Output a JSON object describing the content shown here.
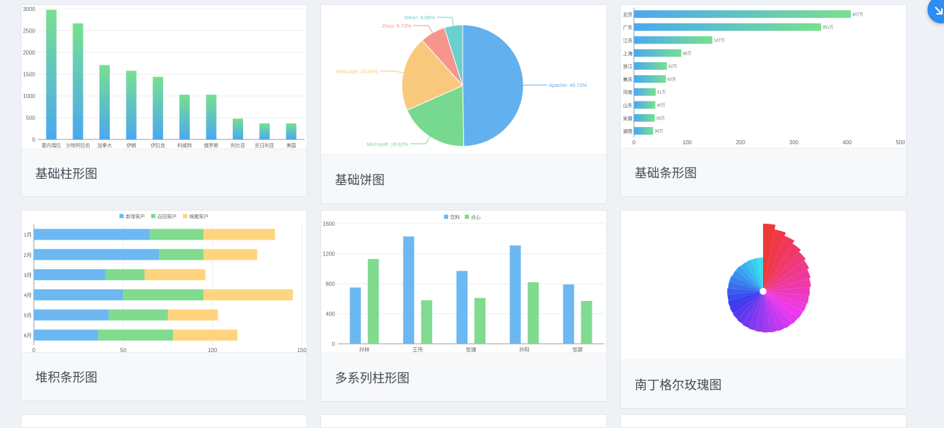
{
  "cards": [
    {
      "id": "basic-bar",
      "caption": "基础柱形图"
    },
    {
      "id": "basic-pie",
      "caption": "基础饼图"
    },
    {
      "id": "basic-hbar",
      "caption": "基础条形图"
    },
    {
      "id": "stacked-hbar",
      "caption": "堆积条形图"
    },
    {
      "id": "multi-bar",
      "caption": "多系列柱形图"
    },
    {
      "id": "rose",
      "caption": "南丁格尔玫瑰图"
    }
  ],
  "chart_data": [
    {
      "type": "bar",
      "categories": [
        "委内瑞拉",
        "沙特阿拉伯",
        "加拿大",
        "伊朗",
        "伊拉克",
        "科威特",
        "俄罗斯",
        "利比亚",
        "尼日利亚",
        "美国"
      ],
      "values": [
        2980,
        2670,
        1710,
        1580,
        1440,
        1030,
        1030,
        480,
        370,
        370
      ],
      "yticks": [
        0,
        500,
        1000,
        1500,
        2000,
        2500,
        3000
      ],
      "ylim": [
        0,
        3000
      ],
      "colors": {
        "top": "#78e08f",
        "bottom": "#4aa8f0"
      }
    },
    {
      "type": "pie",
      "slices": [
        {
          "name": "Apache",
          "value": 49.73,
          "label": "Apache: 49.73%",
          "color": "#62b0ee"
        },
        {
          "name": "Microsoft",
          "value": 18.62,
          "label": "Microsoft: 18.62%",
          "color": "#76d98f"
        },
        {
          "name": "Netscape",
          "value": 20.04,
          "label": "Netscape: 20.04%",
          "color": "#f8c97c"
        },
        {
          "name": "Zeus",
          "value": 6.73,
          "label": "Zeus: 6.73%",
          "color": "#f7958c"
        },
        {
          "name": "Other",
          "value": 4.88,
          "label": "Other: 4.88%",
          "color": "#6bcfcd"
        }
      ]
    },
    {
      "type": "bar-horizontal",
      "categories": [
        "北京",
        "广东",
        "江苏",
        "上海",
        "浙江",
        "重庆",
        "河南",
        "山东",
        "安徽",
        "湖南"
      ],
      "values": [
        407,
        351,
        147,
        89,
        62,
        60,
        41,
        40,
        39,
        36
      ],
      "value_labels": [
        "407万",
        "351万",
        "147万",
        "89万",
        "62万",
        "60万",
        "41万",
        "40万",
        "39万",
        "36万"
      ],
      "xticks": [
        0,
        100,
        200,
        300,
        400,
        500
      ],
      "xlim": [
        0,
        500
      ],
      "colors": {
        "start": "#4aa8f0",
        "end": "#78e08f"
      }
    },
    {
      "type": "bar-horizontal-stacked",
      "categories": [
        "1月",
        "2月",
        "3月",
        "4月",
        "5月",
        "6月"
      ],
      "series": [
        {
          "name": "新增客户",
          "values": [
            65,
            70,
            40,
            50,
            42,
            36
          ],
          "color": "#6cb8f2"
        },
        {
          "name": "召回客户",
          "values": [
            30,
            25,
            22,
            45,
            33,
            42
          ],
          "color": "#80db8f"
        },
        {
          "name": "唤醒客户",
          "values": [
            40,
            30,
            34,
            50,
            28,
            36
          ],
          "color": "#ffd47f"
        }
      ],
      "xticks": [
        0,
        50,
        100,
        150
      ],
      "xlim": [
        0,
        150
      ]
    },
    {
      "type": "bar",
      "categories": [
        "孙林",
        "王伟",
        "张珊",
        "孙阳",
        "张颖"
      ],
      "series": [
        {
          "name": "饮料",
          "values": [
            750,
            1430,
            970,
            1310,
            790
          ],
          "color": "#6cb8f2"
        },
        {
          "name": "点心",
          "values": [
            1130,
            580,
            610,
            820,
            570
          ],
          "color": "#80db8f"
        }
      ],
      "yticks": [
        0,
        400,
        800,
        1200,
        1600
      ],
      "ylim": [
        0,
        1600
      ]
    },
    {
      "type": "rose",
      "sectors": [
        100,
        93,
        88,
        83,
        79,
        76,
        73,
        71,
        69,
        68,
        67,
        66,
        65,
        64,
        63,
        62,
        61,
        60,
        59,
        58,
        57,
        56,
        55,
        54,
        53,
        53,
        52,
        52,
        51,
        51,
        50,
        50,
        50,
        50
      ]
    }
  ]
}
